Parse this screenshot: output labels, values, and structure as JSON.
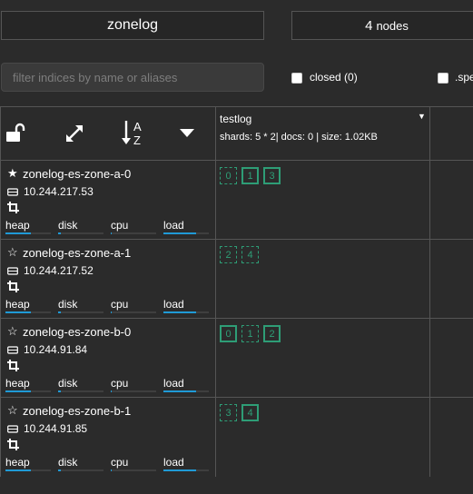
{
  "header": {
    "cluster_name": "zonelog",
    "nodes_count": "4",
    "nodes_label": "nodes"
  },
  "filter": {
    "placeholder": "filter indices by name or aliases",
    "value": ""
  },
  "toggles": {
    "closed_label": "closed (0)",
    "special_label": ".spe"
  },
  "index": {
    "name": "testlog",
    "stats": "shards: 5 * 2| docs: 0 | size: 1.02KB"
  },
  "metric_labels": {
    "heap": "heap",
    "disk": "disk",
    "cpu": "cpu",
    "load": "load"
  },
  "colors": {
    "shard": "#2e9d76",
    "metric_bar": "#1f9ad6",
    "background": "#2b2b2b"
  },
  "nodes": [
    {
      "name": "zonelog-es-zone-a-0",
      "ip": "10.244.217.53",
      "master": true,
      "metrics": {
        "heap": 0.55,
        "disk": 0.06,
        "cpu": 0.02,
        "load": 0.72
      },
      "shards": [
        {
          "id": "0",
          "primary": false
        },
        {
          "id": "1",
          "primary": true
        },
        {
          "id": "3",
          "primary": true
        }
      ]
    },
    {
      "name": "zonelog-es-zone-a-1",
      "ip": "10.244.217.52",
      "master": false,
      "metrics": {
        "heap": 0.55,
        "disk": 0.06,
        "cpu": 0.02,
        "load": 0.72
      },
      "shards": [
        {
          "id": "2",
          "primary": false
        },
        {
          "id": "4",
          "primary": false
        }
      ]
    },
    {
      "name": "zonelog-es-zone-b-0",
      "ip": "10.244.91.84",
      "master": false,
      "metrics": {
        "heap": 0.55,
        "disk": 0.06,
        "cpu": 0.02,
        "load": 0.72
      },
      "shards": [
        {
          "id": "0",
          "primary": true
        },
        {
          "id": "1",
          "primary": false
        },
        {
          "id": "2",
          "primary": true
        }
      ]
    },
    {
      "name": "zonelog-es-zone-b-1",
      "ip": "10.244.91.85",
      "master": false,
      "metrics": {
        "heap": 0.55,
        "disk": 0.06,
        "cpu": 0.02,
        "load": 0.72
      },
      "shards": [
        {
          "id": "3",
          "primary": false
        },
        {
          "id": "4",
          "primary": true
        }
      ]
    }
  ]
}
